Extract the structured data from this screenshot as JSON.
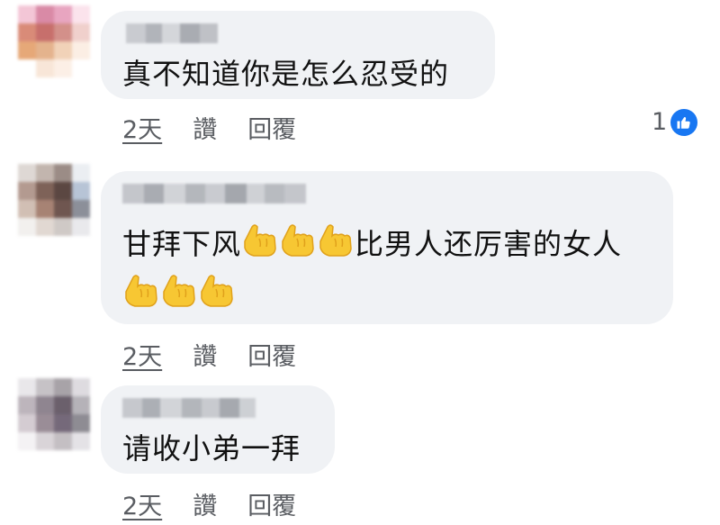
{
  "comments": [
    {
      "text": "真不知道你是怎么忍受的",
      "time": "2天",
      "like_label": "讚",
      "reply_label": "回覆",
      "reaction_count": "1",
      "reaction_icon": "like-icon"
    },
    {
      "text": "甘拜下风",
      "emoji_after_text": "call-me-hand-emoji x3",
      "text2": "比男人还厉害的女人",
      "emoji_line": "call-me-hand-emoji x3",
      "time": "2天",
      "like_label": "讚",
      "reply_label": "回覆"
    },
    {
      "text": "请收小弟一拜",
      "time": "2天",
      "like_label": "讚",
      "reply_label": "回覆"
    }
  ],
  "colors": {
    "bubble": "#f0f2f5",
    "text": "#111111",
    "secondary": "#5a5d62",
    "like_blue": "#1877f2",
    "emoji": "#f7c733"
  }
}
